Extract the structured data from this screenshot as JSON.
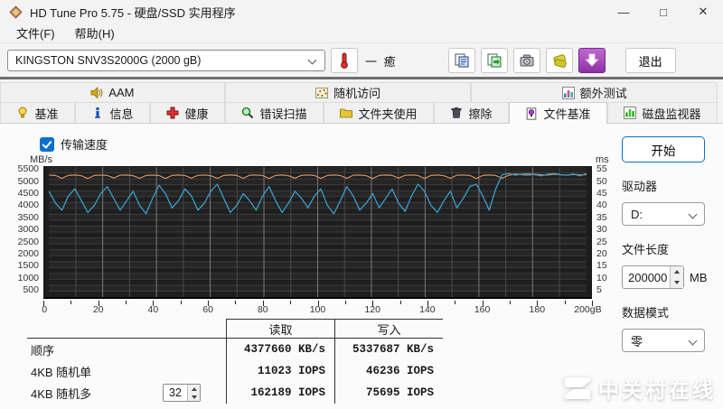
{
  "window": {
    "title": "HD Tune Pro 5.75 - 硬盘/SSD 实用程序",
    "controls": {
      "minimize": "—",
      "maximize": "□",
      "close": "✕"
    }
  },
  "menu": {
    "items": [
      "文件(F)",
      "帮助(H)"
    ]
  },
  "toolbar": {
    "drive_value": "KINGSTON SNV3S2000G (2000 gB)",
    "temp_display": "一 癒",
    "exit_label": "退出"
  },
  "tabs": {
    "row1": [
      {
        "id": "aam",
        "label": "AAM",
        "icon": "speaker-icon"
      },
      {
        "id": "random-access",
        "label": "随机访问",
        "icon": "random-access-icon"
      },
      {
        "id": "extra-tests",
        "label": "额外测试",
        "icon": "extra-tests-icon"
      }
    ],
    "row2": [
      {
        "id": "benchmark",
        "label": "基准",
        "icon": "lightbulb-icon"
      },
      {
        "id": "info",
        "label": "信息",
        "icon": "info-icon"
      },
      {
        "id": "health",
        "label": "健康",
        "icon": "health-cross-icon"
      },
      {
        "id": "error-scan",
        "label": "错误扫描",
        "icon": "magnifier-icon"
      },
      {
        "id": "folder-usage",
        "label": "文件夹使用",
        "icon": "folder-icon"
      },
      {
        "id": "erase",
        "label": "擦除",
        "icon": "trash-icon"
      },
      {
        "id": "file-benchmark",
        "label": "文件基准",
        "icon": "file-benchmark-icon",
        "selected": true
      },
      {
        "id": "disk-monitor",
        "label": "磁盘监视器",
        "icon": "disk-monitor-icon"
      }
    ]
  },
  "benchmark": {
    "checkbox_label": "传输速度",
    "checked": true
  },
  "chart_data": {
    "type": "line",
    "x_axis": {
      "min": 0,
      "max": 200,
      "grid_step": 10,
      "tick_labels": [
        "0",
        "20",
        "40",
        "60",
        "80",
        "100",
        "120",
        "140",
        "160",
        "180",
        "200gB"
      ]
    },
    "y_axis_left": {
      "label": "MB/s",
      "min": 125,
      "max": 5625,
      "grid_step": 250,
      "tick_labels": [
        "5500",
        "5000",
        "4500",
        "4000",
        "3500",
        "3000",
        "2500",
        "2000",
        "1500",
        "1000",
        "500"
      ]
    },
    "y_axis_right": {
      "label": "ms",
      "tick_labels": [
        "55",
        "50",
        "45",
        "40",
        "35",
        "30",
        "25",
        "20",
        "15",
        "10",
        "5"
      ],
      "scale_factor": 100
    },
    "grid": true,
    "legend": "none",
    "series": [
      {
        "name": "orange-line",
        "color": "#cf8d5e",
        "y_values": [
          5280,
          5270,
          5150,
          5270,
          5290,
          5260,
          5140,
          5270,
          5280,
          5270,
          5160,
          5280,
          5290,
          5260,
          5150,
          5270,
          5280,
          5270,
          5140,
          5270,
          5290,
          5265,
          5155,
          5275,
          5285,
          5260,
          5145,
          5270,
          5290,
          5270,
          5150,
          5280,
          5285,
          5265,
          5140,
          5270,
          5290,
          5260,
          5155,
          5275,
          5285,
          5270,
          5145,
          5270,
          5290,
          5265,
          5150,
          5280,
          5285,
          5260,
          5140,
          5270,
          5290,
          5270,
          5155,
          5275,
          5285,
          5265,
          5145,
          5270,
          5290,
          5260,
          5150,
          5280,
          5285,
          5270,
          5140,
          5270,
          5290,
          5265,
          5155,
          5275,
          5330,
          5300,
          5280,
          5320,
          5300,
          5290,
          5320,
          5300,
          5280,
          5310,
          5290,
          5300
        ]
      },
      {
        "name": "blue-line",
        "color": "#3a9fce",
        "y_values": [
          4600,
          4100,
          3800,
          4400,
          4700,
          4200,
          3700,
          4000,
          4500,
          4800,
          4300,
          3800,
          4200,
          4600,
          4000,
          3650,
          4300,
          4850,
          4500,
          3900,
          4200,
          4700,
          4400,
          3800,
          4100,
          4600,
          4900,
          4300,
          3700,
          4000,
          4500,
          4200,
          3800,
          4400,
          4800,
          4200,
          3700,
          4100,
          4600,
          4300,
          3900,
          4400,
          4700,
          4000,
          3650,
          4200,
          4800,
          4400,
          3800,
          4100,
          4500,
          3900,
          4300,
          4700,
          4100,
          3750,
          4400,
          4900,
          4600,
          4000,
          3700,
          4200,
          4600,
          3900,
          4300,
          4800,
          4900,
          4400,
          3800,
          4700,
          5300,
          5350,
          5280,
          5320,
          5350,
          5300,
          5250,
          5320,
          5350,
          5300,
          5280,
          5330,
          5250,
          5350
        ]
      }
    ]
  },
  "table": {
    "headers": {
      "read": "读取",
      "write": "写入"
    },
    "rows": [
      {
        "label": "顺序",
        "read": "4377660 KB/s",
        "write": "5337687 KB/s"
      },
      {
        "label": "4KB 随机单",
        "read": "11023 IOPS",
        "write": "46236 IOPS"
      },
      {
        "label": "4KB 随机多",
        "spinner": "32",
        "read": "162189 IOPS",
        "write": "75695 IOPS"
      }
    ]
  },
  "controls": {
    "start": "开始",
    "drive_label": "驱动器",
    "drive_value": "D:",
    "length_label": "文件长度",
    "length_value": "200000",
    "length_unit": "MB",
    "mode_label": "数据模式",
    "mode_value": "零"
  },
  "watermark": {
    "text": "中关村在线"
  }
}
